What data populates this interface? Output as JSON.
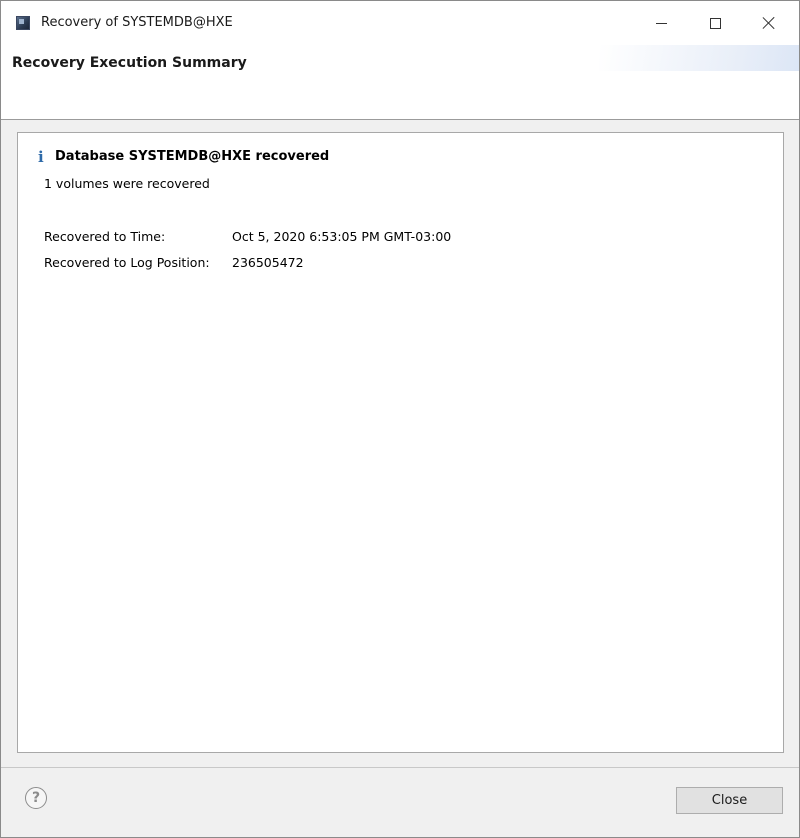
{
  "window": {
    "title": "Recovery of SYSTEMDB@HXE",
    "app_icon": "sap-hana-studio-icon",
    "controls": {
      "minimize_icon": "minimize-icon",
      "maximize_icon": "maximize-icon",
      "close_icon": "close-icon"
    }
  },
  "header": {
    "title": "Recovery Execution Summary"
  },
  "summary": {
    "status_icon": "info-icon",
    "status_glyph": "i",
    "title": "Database SYSTEMDB@HXE recovered",
    "subtitle": "1 volumes were recovered",
    "details": [
      {
        "label": "Recovered to Time:",
        "value": "Oct 5, 2020 6:53:05 PM GMT-03:00"
      },
      {
        "label": "Recovered to Log Position:",
        "value": "236505472"
      }
    ]
  },
  "footer": {
    "help_icon": "help-icon",
    "help_glyph": "?",
    "close_label": "Close"
  },
  "colors": {
    "info_icon": "#2e6aa8",
    "dialog_background": "#f0f0f0",
    "panel_background": "#ffffff",
    "button_background": "#e1e1e1"
  }
}
